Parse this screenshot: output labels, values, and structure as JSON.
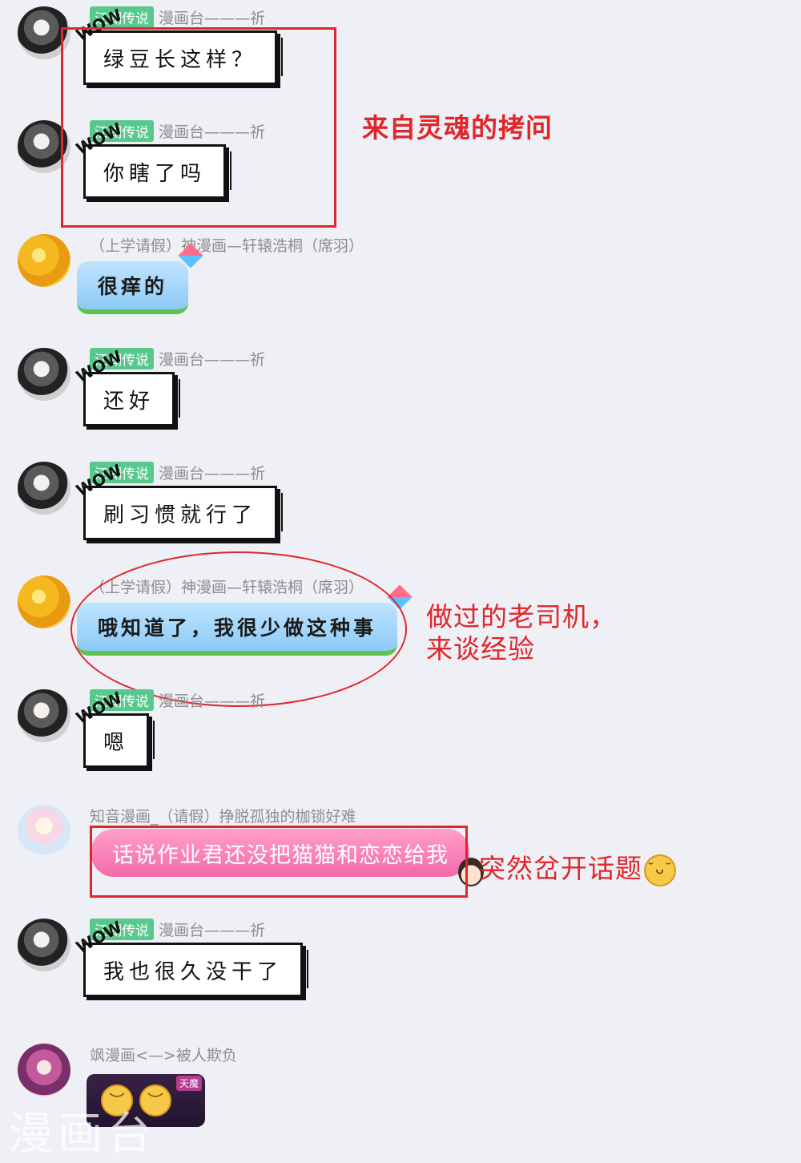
{
  "messages": [
    {
      "sender_tag": "江湖传说",
      "sender_name": "漫画台———祈",
      "text": "绿豆长这样？",
      "style": "comic",
      "avatar": "girl-avatar"
    },
    {
      "sender_tag": "江湖传说",
      "sender_name": "漫画台———祈",
      "text": "你瞎了吗",
      "style": "comic",
      "avatar": "girl-avatar"
    },
    {
      "sender_tag": "",
      "sender_name": "（上学请假）神漫画—轩辕浩桐（席羽）",
      "text": "很痒的",
      "style": "sky",
      "avatar": "orange-avatar"
    },
    {
      "sender_tag": "江湖传说",
      "sender_name": "漫画台———祈",
      "text": "还好",
      "style": "comic",
      "avatar": "girl-avatar"
    },
    {
      "sender_tag": "江湖传说",
      "sender_name": "漫画台———祈",
      "text": "刷习惯就行了",
      "style": "comic",
      "avatar": "girl-avatar"
    },
    {
      "sender_tag": "",
      "sender_name": "（上学请假）神漫画—轩辕浩桐（席羽）",
      "text": "哦知道了，我很少做这种事",
      "style": "sky",
      "avatar": "orange-avatar"
    },
    {
      "sender_tag": "江湖传说",
      "sender_name": "漫画台———祈",
      "text": "嗯",
      "style": "comic",
      "avatar": "girl-avatar"
    },
    {
      "sender_tag": "",
      "sender_name": "知音漫画_（请假）挣脱孤独的枷锁好难",
      "text": "话说作业君还没把猫猫和恋恋给我",
      "style": "pink",
      "avatar": "pastel-avatar"
    },
    {
      "sender_tag": "江湖传说",
      "sender_name": "漫画台———祈",
      "text": "我也很久没干了",
      "style": "comic",
      "avatar": "girl-avatar"
    },
    {
      "sender_tag": "",
      "sender_name": "飒漫画<—>被人欺负",
      "text": "",
      "style": "dark",
      "avatar": "pink-avatar",
      "badge": "天魔"
    }
  ],
  "wow_label": "WOW",
  "annotations": {
    "note1": "来自灵魂的拷问",
    "note2_line1": "做过的老司机，",
    "note2_line2": "来谈经验",
    "note3": "突然岔开话题"
  },
  "watermark": "漫画台",
  "colors": {
    "background": "#eef0f6",
    "tag_green": "#57c98c",
    "annotation_red": "#e0262a"
  }
}
